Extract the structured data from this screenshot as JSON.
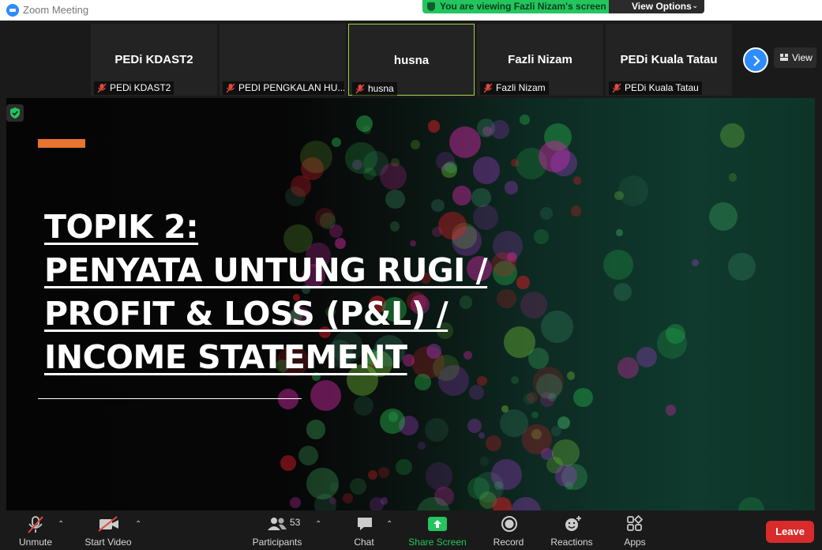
{
  "window": {
    "title": "Zoom Meeting"
  },
  "banner": {
    "viewing_text": "You are viewing Fazli Nizam's screen",
    "view_options_label": "View Options"
  },
  "gallery": {
    "tiles": [
      {
        "display_name": "PEDi KDAST2",
        "label": "PEDi KDAST2",
        "muted": true
      },
      {
        "display_name": "",
        "label": "PEDI PENGKALAN HU...",
        "muted": true
      },
      {
        "display_name": "husna",
        "label": "husna",
        "muted": true,
        "active_speaker": true
      },
      {
        "display_name": "Fazli Nizam",
        "label": "Fazli Nizam",
        "muted": true
      },
      {
        "display_name": "PEDi Kuala Tatau",
        "label": "PEDi Kuala Tatau",
        "muted": true
      }
    ],
    "view_label": "View"
  },
  "slide": {
    "title_lines": [
      "TOPIK 2:",
      "PENYATA UNTUNG RUGI /",
      "PROFIT & LOSS (P&L) /",
      "INCOME STATEMENT"
    ]
  },
  "toolbar": {
    "unmute": "Unmute",
    "start_video": "Start Video",
    "participants": "Participants",
    "participant_count": "53",
    "chat": "Chat",
    "share_screen": "Share Screen",
    "record": "Record",
    "reactions": "Reactions",
    "apps": "Apps",
    "leave": "Leave"
  },
  "colors": {
    "accent_green": "#23c55e",
    "zoom_blue": "#2d8cff",
    "leave_red": "#d82b2b",
    "slide_accent_orange": "#e8742f"
  }
}
